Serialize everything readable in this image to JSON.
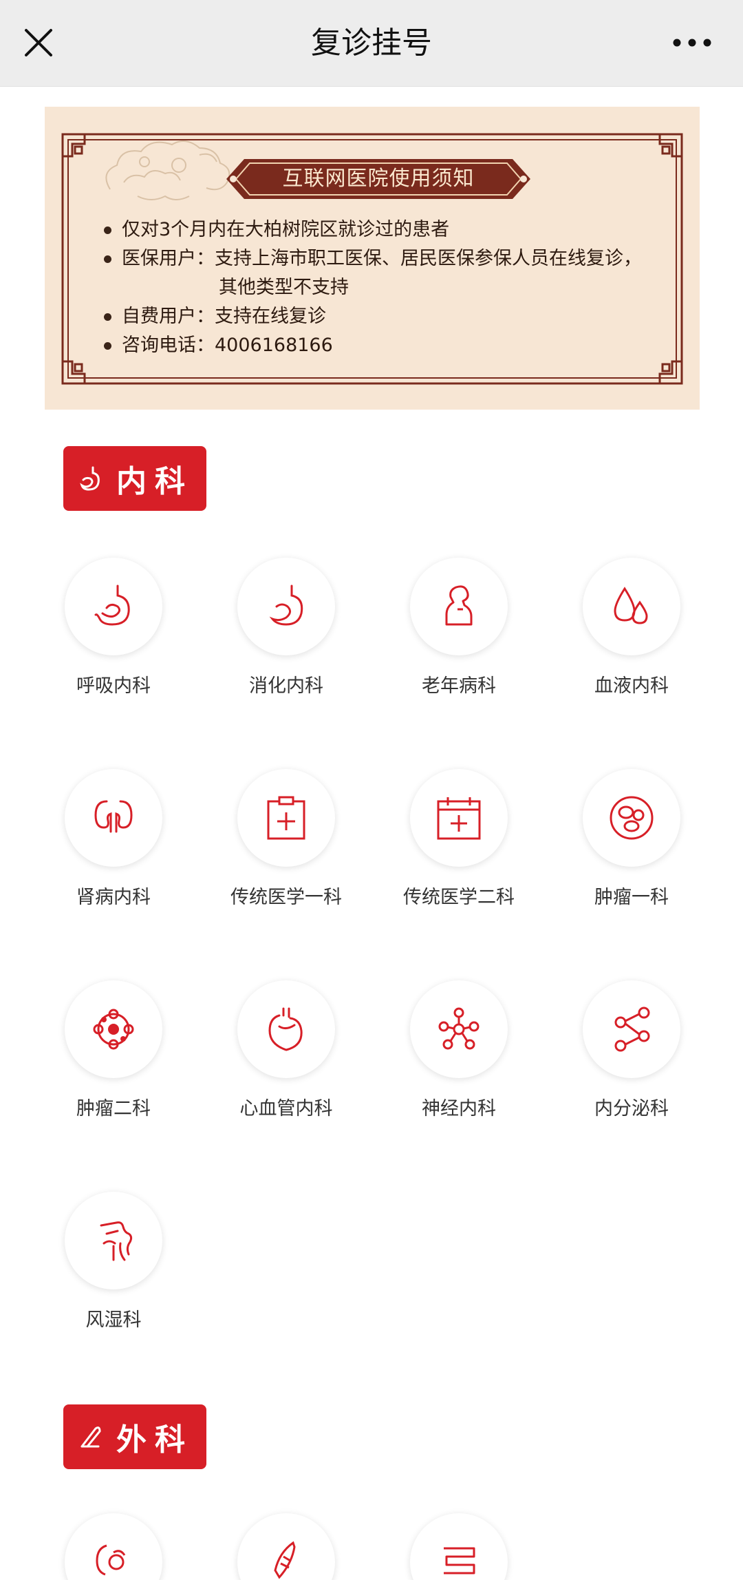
{
  "header": {
    "title": "复诊挂号",
    "close_icon": "close-icon",
    "more_icon": "more-icon"
  },
  "notice": {
    "title": "互联网医院使用须知",
    "items": [
      {
        "label": "仅对3个月内在大柏树院区就诊过的患者"
      },
      {
        "label": "医保用户：支持上海市职工医保、居民医保参保人员在线复诊，",
        "cont": "其他类型不支持"
      },
      {
        "label": "自费用户：支持在线复诊"
      },
      {
        "label": "咨询电话：4006168166"
      }
    ]
  },
  "sections": [
    {
      "title": "内科",
      "icon": "stomach-icon",
      "departments": [
        {
          "name": "呼吸内科",
          "icon": "stomach-icon"
        },
        {
          "name": "消化内科",
          "icon": "stomach-icon"
        },
        {
          "name": "老年病科",
          "icon": "elderly-icon"
        },
        {
          "name": "血液内科",
          "icon": "blood-drop-icon"
        },
        {
          "name": "肾病内科",
          "icon": "kidney-icon"
        },
        {
          "name": "传统医学一科",
          "icon": "clipboard-plus-icon"
        },
        {
          "name": "传统医学二科",
          "icon": "calendar-plus-icon"
        },
        {
          "name": "肿瘤一科",
          "icon": "cell-icon"
        },
        {
          "name": "肿瘤二科",
          "icon": "tumor-icon"
        },
        {
          "name": "心血管内科",
          "icon": "heart-icon"
        },
        {
          "name": "神经内科",
          "icon": "neuron-icon"
        },
        {
          "name": "内分泌科",
          "icon": "molecule-icon"
        },
        {
          "name": "风湿科",
          "icon": "joint-icon"
        }
      ]
    },
    {
      "title": "外科",
      "icon": "scalpel-icon",
      "departments": [
        {
          "name": "",
          "icon": "surgery-icon-1"
        },
        {
          "name": "",
          "icon": "surgery-icon-2"
        },
        {
          "name": "",
          "icon": "intestine-icon"
        }
      ]
    }
  ],
  "colors": {
    "accent": "#d71f27",
    "notice_bg": "#f7e6d4",
    "notice_border": "#7a2a1d",
    "topbar_bg": "#ededed"
  }
}
